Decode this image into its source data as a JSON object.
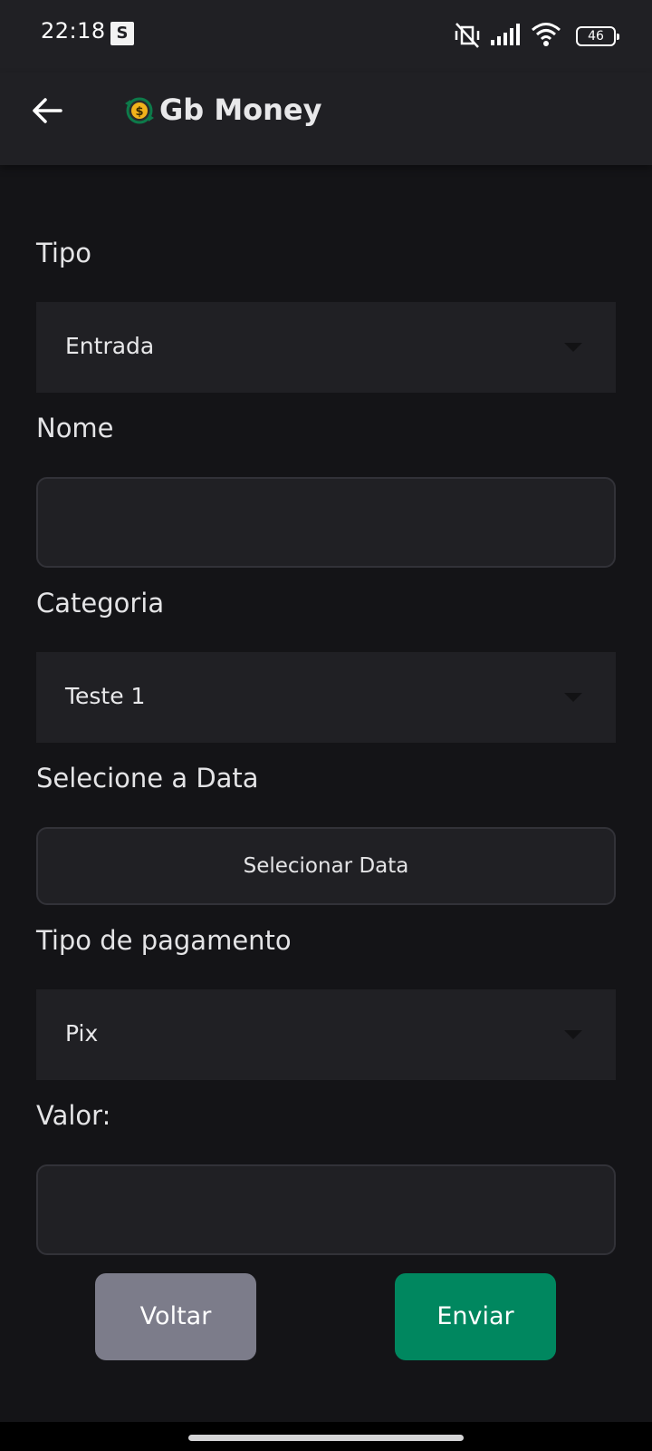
{
  "status_bar": {
    "time": "22:18",
    "badge": "S",
    "battery": "46",
    "icons": [
      "mute-vibrate-icon",
      "signal-icon",
      "wifi-icon",
      "battery-icon"
    ]
  },
  "app_bar": {
    "title": "Gb Money",
    "back_icon": "arrow-left-icon",
    "logo_icon": "money-logo-icon"
  },
  "form": {
    "tipo": {
      "label": "Tipo",
      "value": "Entrada"
    },
    "nome": {
      "label": "Nome",
      "value": ""
    },
    "categoria": {
      "label": "Categoria",
      "value": "Teste 1"
    },
    "data": {
      "label": "Selecione a Data",
      "button": "Selecionar Data"
    },
    "pagamento": {
      "label": "Tipo de pagamento",
      "value": "Pix"
    },
    "valor": {
      "label": "Valor:",
      "value": ""
    }
  },
  "actions": {
    "back_label": "Voltar",
    "send_label": "Enviar"
  },
  "colors": {
    "background": "#141417",
    "surface": "#202024",
    "border": "#323238",
    "secondary_button": "#7c7c8a",
    "primary_button": "#00875f"
  }
}
